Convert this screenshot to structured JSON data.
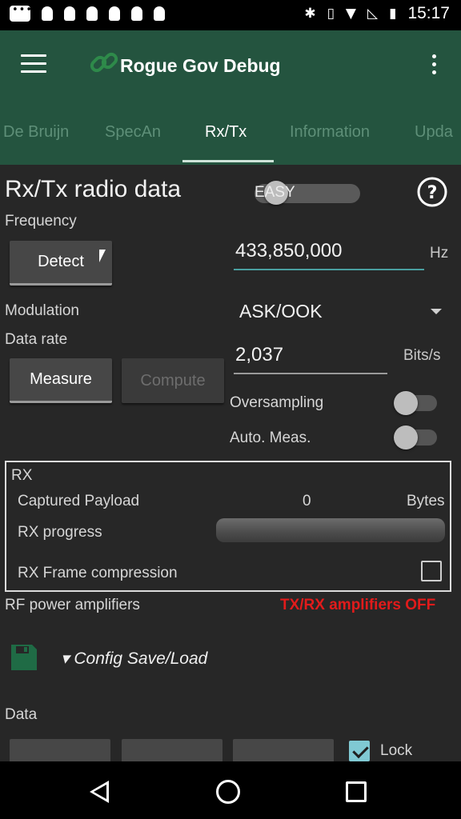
{
  "status_bar": {
    "time": "15:17"
  },
  "app_bar": {
    "title": "Rogue Gov Debug"
  },
  "tabs": [
    {
      "label": "De Bruijn"
    },
    {
      "label": "SpecAn"
    },
    {
      "label": "Rx/Tx"
    },
    {
      "label": "Information"
    },
    {
      "label": "Upda"
    }
  ],
  "page": {
    "title": "Rx/Tx radio data",
    "mode_switch_label": "EASY",
    "frequency_label": "Frequency",
    "detect_button": "Detect",
    "frequency_value": "433,850,000",
    "frequency_unit": "Hz",
    "modulation_label": "Modulation",
    "modulation_value": "ASK/OOK",
    "data_rate_label": "Data rate",
    "data_rate_value": "2,037",
    "data_rate_unit": "Bits/s",
    "measure_button": "Measure",
    "compute_button": "Compute",
    "oversampling_label": "Oversampling",
    "auto_meas_label": "Auto. Meas."
  },
  "rx": {
    "section_label": "RX",
    "captured_payload_label": "Captured Payload",
    "captured_payload_value": "0",
    "captured_payload_unit": "Bytes",
    "progress_label": "RX progress",
    "frame_compression_label": "RX Frame compression"
  },
  "rf": {
    "label": "RF power amplifiers",
    "status": "TX/RX amplifiers OFF"
  },
  "config": {
    "label": "▾ Config Save/Load"
  },
  "data_section": {
    "label": "Data",
    "lock_label": "Lock"
  },
  "colors": {
    "app_bar": "#24543f",
    "accent": "#4a9fa0",
    "warning": "#e11b1b",
    "background": "#272727"
  }
}
